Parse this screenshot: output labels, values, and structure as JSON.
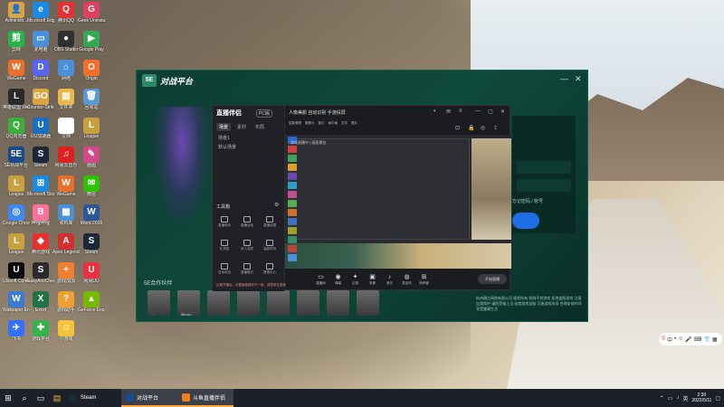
{
  "desktop": {
    "icons": [
      {
        "label": "Administr...",
        "glyph": "👤",
        "color": "#d9a441"
      },
      {
        "label": "Microsoft Edge",
        "glyph": "e",
        "color": "#1c8ae0"
      },
      {
        "label": "腾讯QQ",
        "glyph": "Q",
        "color": "#e83030"
      },
      {
        "label": "Geek Uninstaller",
        "glyph": "G",
        "color": "#e04060"
      },
      {
        "label": "剪映",
        "glyph": "剪",
        "color": "#27b34a"
      },
      {
        "label": "此电脑",
        "glyph": "▭",
        "color": "#4a90d9"
      },
      {
        "label": "OBS Studio",
        "glyph": "●",
        "color": "#303030"
      },
      {
        "label": "Google Play",
        "glyph": "▶",
        "color": "#34a853"
      },
      {
        "label": "WeGame",
        "glyph": "W",
        "color": "#e8702a"
      },
      {
        "label": "Discord",
        "glyph": "D",
        "color": "#5865f2"
      },
      {
        "label": "网络",
        "glyph": "⌂",
        "color": "#4a90d9"
      },
      {
        "label": "Origin",
        "glyph": "O",
        "color": "#f56c2d"
      },
      {
        "label": "英雄联盟 WeGame",
        "glyph": "L",
        "color": "#2a2a2a"
      },
      {
        "label": "Counter-Strike GO",
        "glyph": "GO",
        "color": "#d9a441"
      },
      {
        "label": "文件夹",
        "glyph": "▤",
        "color": "#e8b84a"
      },
      {
        "label": "回收站",
        "glyph": "🗑",
        "color": "#5a9ad0"
      },
      {
        "label": "QQ浏览器",
        "glyph": "Q",
        "color": "#3ab03a"
      },
      {
        "label": "UU加速器",
        "glyph": "U",
        "color": "#1a6ec0"
      },
      {
        "label": "文档",
        "glyph": "▯",
        "color": "#ffffff"
      },
      {
        "label": "League",
        "glyph": "L",
        "color": "#c8a040"
      },
      {
        "label": "5E对战平台",
        "glyph": "5E",
        "color": "#1a4a8a"
      },
      {
        "label": "Steam",
        "glyph": "S",
        "color": "#1b2838"
      },
      {
        "label": "网易云音乐",
        "glyph": "♫",
        "color": "#e02020"
      },
      {
        "label": "画图",
        "glyph": "✎",
        "color": "#d04a8a"
      },
      {
        "label": "League",
        "glyph": "L",
        "color": "#c8a040"
      },
      {
        "label": "Microsoft Store",
        "glyph": "⊞",
        "color": "#1c8ae0"
      },
      {
        "label": "WeGame",
        "glyph": "W",
        "color": "#e8702a"
      },
      {
        "label": "微信",
        "glyph": "✉",
        "color": "#2dc100"
      },
      {
        "label": "Google Chrome",
        "glyph": "◎",
        "color": "#4285f4"
      },
      {
        "label": "哔哩哔哩",
        "glyph": "B",
        "color": "#fb7299"
      },
      {
        "label": "资料库",
        "glyph": "▦",
        "color": "#4a90d9"
      },
      {
        "label": "Word 2016",
        "glyph": "W",
        "color": "#2b579a"
      },
      {
        "label": "League",
        "glyph": "L",
        "color": "#c8a040"
      },
      {
        "label": "腾讯游戏",
        "glyph": "◆",
        "color": "#e83030"
      },
      {
        "label": "Apex Legends",
        "glyph": "A",
        "color": "#d32f2f"
      },
      {
        "label": "Steam",
        "glyph": "S",
        "color": "#1b2838"
      },
      {
        "label": "Ubisoft Connect",
        "glyph": "U",
        "color": "#0a0a0a"
      },
      {
        "label": "EasyAntiCheat",
        "glyph": "S",
        "color": "#2a2a2a"
      },
      {
        "label": "游戏加加",
        "glyph": "+",
        "color": "#f08030"
      },
      {
        "label": "网易UU",
        "glyph": "U",
        "color": "#e83040"
      },
      {
        "label": "Wallpaper Engine",
        "glyph": "W",
        "color": "#3a7ad0"
      },
      {
        "label": "Excel",
        "glyph": "X",
        "color": "#217346"
      },
      {
        "label": "游戏助手",
        "glyph": "?",
        "color": "#f0a030"
      },
      {
        "label": "GeForce Experience",
        "glyph": "▲",
        "color": "#76b900"
      },
      {
        "label": "飞书",
        "glyph": "✈",
        "color": "#3370ff"
      },
      {
        "label": "游戏平台",
        "glyph": "✚",
        "color": "#33b34a"
      },
      {
        "label": "小游戏",
        "glyph": "☺",
        "color": "#f5c33a"
      }
    ]
  },
  "launcher": {
    "title": "对战平台",
    "logo": "5E",
    "login_links": "忘记密码 / 账号",
    "friends_title": "5E合作伙伴",
    "friends": [
      "...",
      "Miracl...",
      "",
      "",
      "",
      "",
      "",
      ""
    ],
    "footer": "杭州雅吉网络有限公司 版权所有 抵制不良游戏 拒绝盗版游戏 注意自我保护 谨防受骗上当 适度游戏益脑 沉迷游戏伤身 合理安排时间 享受健康生活"
  },
  "stream_app": {
    "logo": "直播伴侣",
    "logo_badge": "PC版",
    "tabs": [
      "场景",
      "素材",
      "布局"
    ],
    "scenes": [
      "场景1",
      "默认场景"
    ],
    "tools_title": "工具箱",
    "tools": [
      "直播助手",
      "直播活动",
      "直播设置",
      "礼物盒",
      "多人连麦",
      "高能时刻",
      "互动玩法",
      "直播模式",
      "数据中心"
    ],
    "notice": "近期开播后，设置面板操作不一致，请您前往更新",
    "title": "人像美颜 自动识别 手游投屏",
    "sub_items": [
      "智能美颜",
      "摄像头",
      "窗口",
      "画中画",
      "文字",
      "图片"
    ],
    "preview_caption": "游戏直播中 | 画面预览",
    "bottom_buttons": [
      {
        "glyph": "▭",
        "label": "直播间"
      },
      {
        "glyph": "◉",
        "label": "弹幕"
      },
      {
        "glyph": "✦",
        "label": "礼物"
      },
      {
        "glyph": "▣",
        "label": "录像"
      },
      {
        "glyph": "♪",
        "label": "音乐"
      },
      {
        "glyph": "◍",
        "label": "麦克风"
      },
      {
        "glyph": "⊞",
        "label": "扬声器"
      }
    ],
    "live_button": "开始直播"
  },
  "taskbar": {
    "apps": [
      {
        "label": "Steam",
        "color": "#1b2838",
        "active": false
      },
      {
        "label": "对战平台",
        "color": "#1a4a8a",
        "active": true
      },
      {
        "label": "斗鱼直播伴侣",
        "color": "#f5801a",
        "active": true
      }
    ],
    "clock_time": "2:30",
    "clock_date": "2022/5/11",
    "ime_text": "中"
  }
}
